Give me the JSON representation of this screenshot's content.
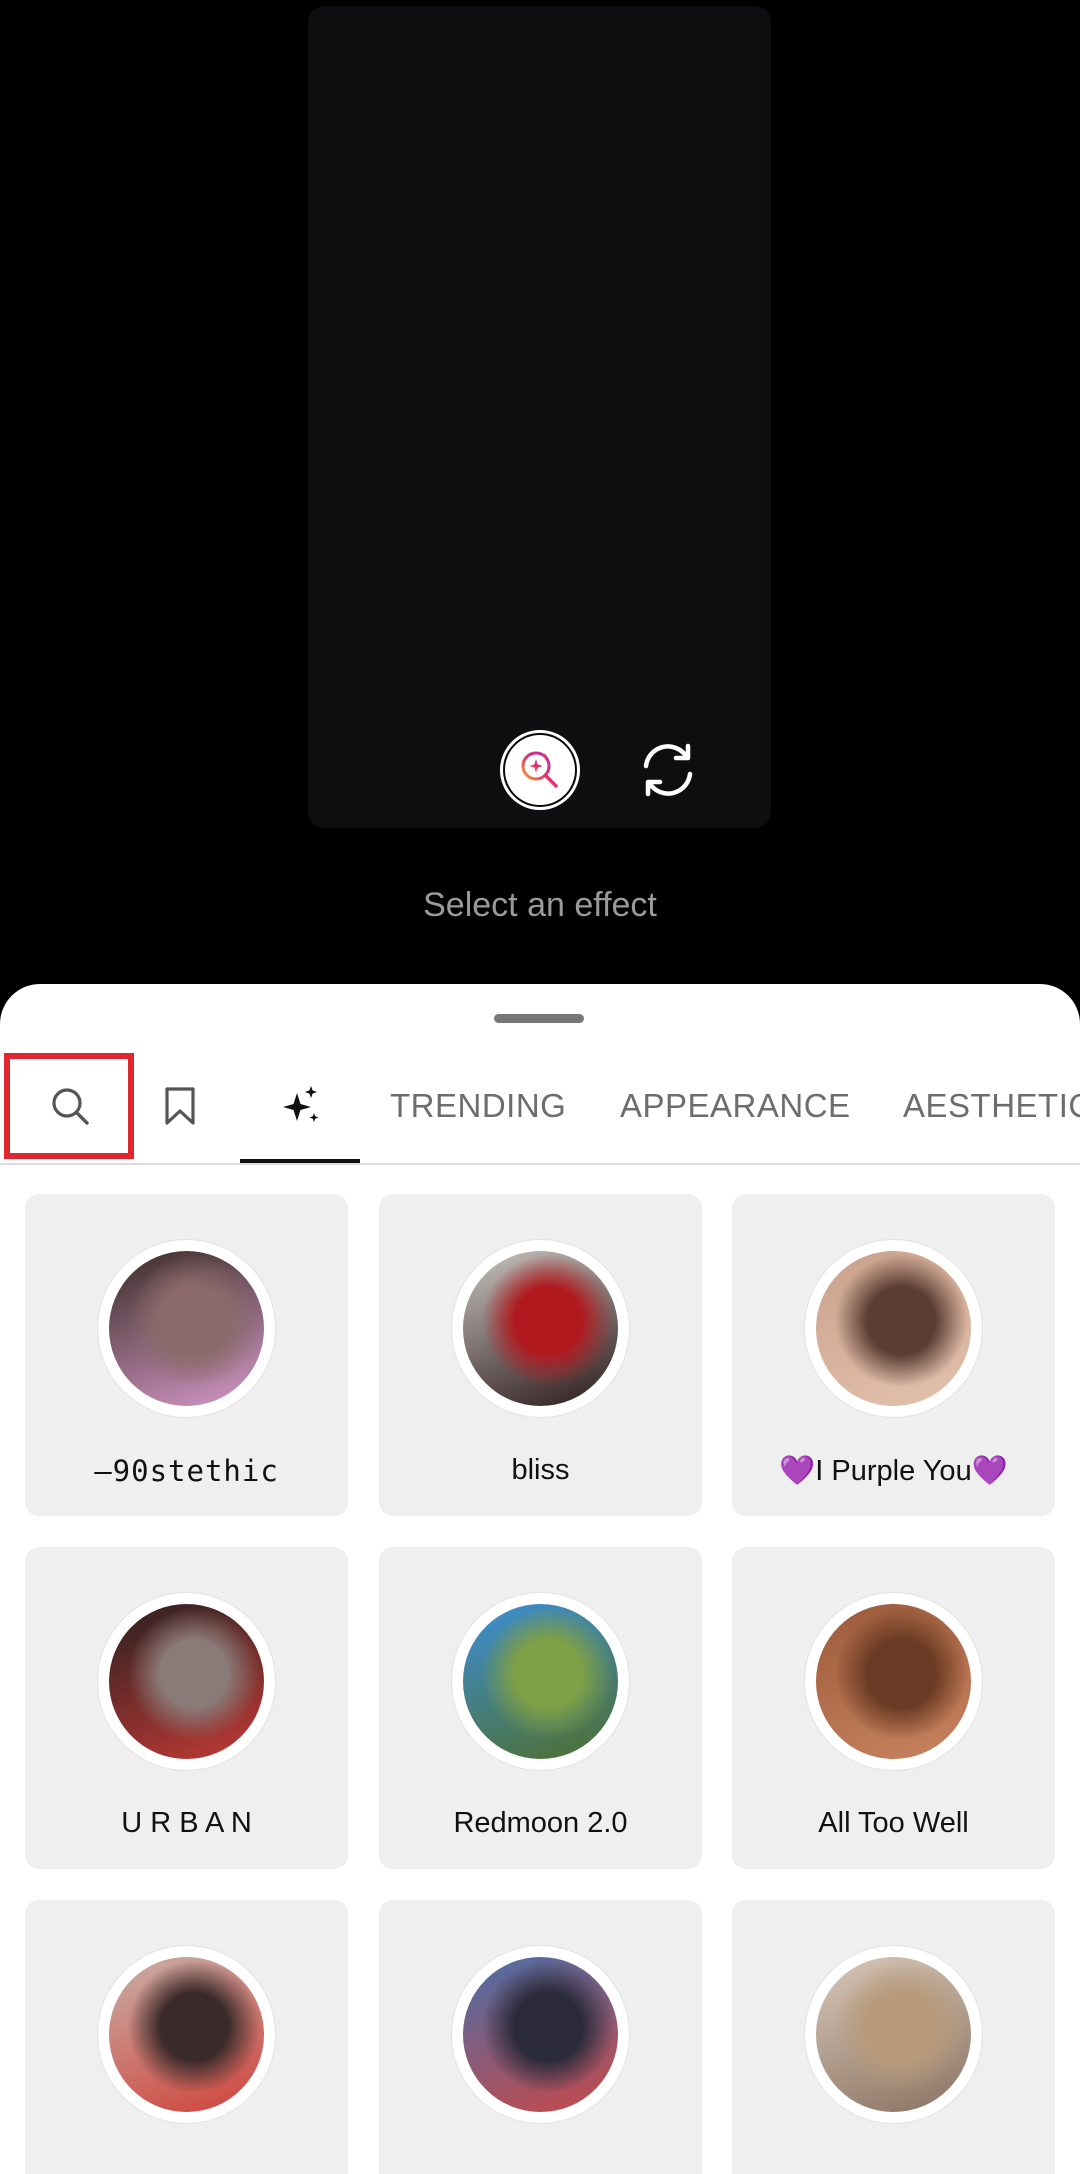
{
  "camera": {
    "select_effect_label": "Select an effect"
  },
  "tabs": {
    "search_icon": "search-icon",
    "saved_icon": "bookmark-icon",
    "effects_icon": "sparkle-icon",
    "categories": [
      "TRENDING",
      "APPEARANCE",
      "AESTHETIC"
    ]
  },
  "effects": [
    {
      "label": "—90stethic",
      "colors": [
        "#3a2b26",
        "#8c6a6a",
        "#d59ac8"
      ]
    },
    {
      "label": "bliss",
      "colors": [
        "#c9c4c0",
        "#b01a1f",
        "#2a1a1a"
      ]
    },
    {
      "label": "💜I Purple You💜",
      "colors": [
        "#c9a08a",
        "#5b3d33",
        "#e3c2ae"
      ]
    },
    {
      "label": "U R B A N",
      "colors": [
        "#2a2020",
        "#8a7a78",
        "#c23a35"
      ]
    },
    {
      "label": "Redmoon 2.0",
      "colors": [
        "#3c8fd6",
        "#7ea046",
        "#4f6e2c"
      ]
    },
    {
      "label": "All Too Well",
      "colors": [
        "#9a5a3a",
        "#6a3a24",
        "#c98460"
      ]
    },
    {
      "label": "",
      "colors": [
        "#c8b0a8",
        "#3a2a2a",
        "#d0423a"
      ]
    },
    {
      "label": "",
      "colors": [
        "#4a6ea8",
        "#2a2a3a",
        "#c84848"
      ]
    },
    {
      "label": "",
      "colors": [
        "#d8c8b8",
        "#b89a7a",
        "#8a7262"
      ]
    }
  ],
  "accent": "#e0262f"
}
